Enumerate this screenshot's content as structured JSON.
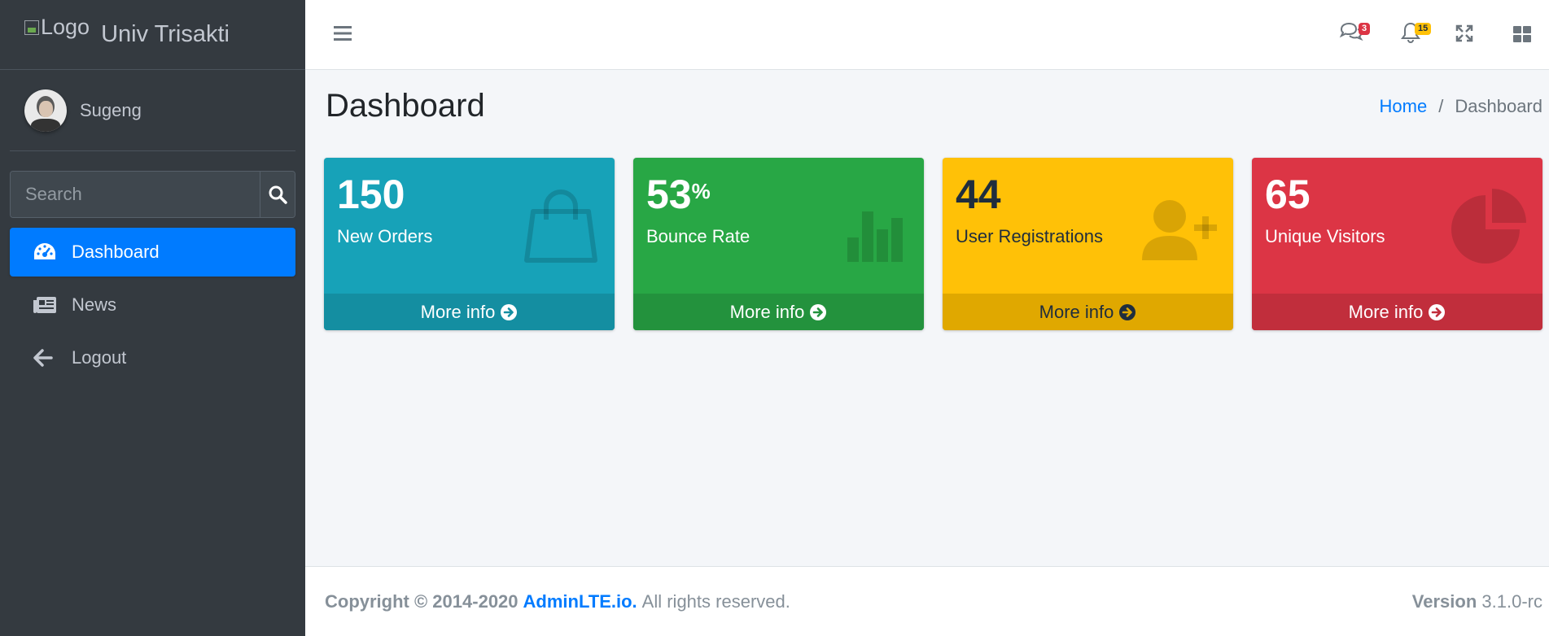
{
  "brand": {
    "logo_alt": "Logo",
    "name": "Univ Trisakti"
  },
  "user": {
    "name": "Sugeng"
  },
  "search": {
    "placeholder": "Search"
  },
  "nav": {
    "dashboard": "Dashboard",
    "news": "News",
    "logout": "Logout"
  },
  "topbar": {
    "messages_count": "3",
    "notifications_count": "15"
  },
  "header": {
    "title": "Dashboard",
    "breadcrumb_home": "Home",
    "breadcrumb_sep": "/",
    "breadcrumb_current": "Dashboard"
  },
  "boxes": [
    {
      "value": "150",
      "suffix": "",
      "label": "New Orders",
      "link": "More info",
      "color": "#17a2b8",
      "icon": "shopping-bag-icon"
    },
    {
      "value": "53",
      "suffix": "%",
      "label": "Bounce Rate",
      "link": "More info",
      "color": "#28a745",
      "icon": "bar-chart-icon"
    },
    {
      "value": "44",
      "suffix": "",
      "label": "User Registrations",
      "link": "More info",
      "color": "#ffc107",
      "icon": "user-plus-icon"
    },
    {
      "value": "65",
      "suffix": "",
      "label": "Unique Visitors",
      "link": "More info",
      "color": "#dc3545",
      "icon": "pie-chart-icon"
    }
  ],
  "footer": {
    "copyright": "Copyright © 2014-2020",
    "brand_link": "AdminLTE.io.",
    "rights": "All rights reserved.",
    "version_label": "Version",
    "version_value": "3.1.0-rc"
  },
  "colors": {
    "primary": "#007bff",
    "sidebar": "#343a40"
  }
}
